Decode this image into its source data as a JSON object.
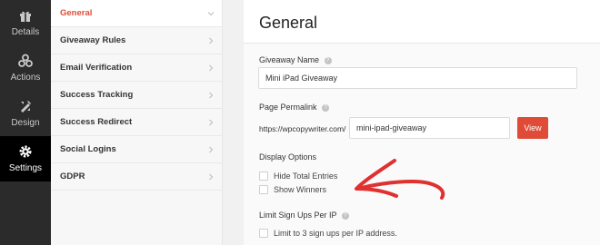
{
  "rail": {
    "items": [
      {
        "label": "Details",
        "icon": "gift-icon"
      },
      {
        "label": "Actions",
        "icon": "actions-icon"
      },
      {
        "label": "Design",
        "icon": "design-icon"
      },
      {
        "label": "Settings",
        "icon": "gear-icon"
      }
    ],
    "active": "Settings"
  },
  "subnav": {
    "items": [
      {
        "label": "General"
      },
      {
        "label": "Giveaway Rules"
      },
      {
        "label": "Email Verification"
      },
      {
        "label": "Success Tracking"
      },
      {
        "label": "Success Redirect"
      },
      {
        "label": "Social Logins"
      },
      {
        "label": "GDPR"
      }
    ],
    "active": "General"
  },
  "main": {
    "title": "General",
    "giveaway_name": {
      "label": "Giveaway Name",
      "value": "Mini iPad Giveaway"
    },
    "permalink": {
      "label": "Page Permalink",
      "prefix": "https://wpcopywriter.com/",
      "value": "mini-ipad-giveaway",
      "view_button": "View"
    },
    "display_options": {
      "label": "Display Options",
      "options": [
        {
          "label": "Hide Total Entries",
          "checked": false
        },
        {
          "label": "Show Winners",
          "checked": false
        }
      ]
    },
    "limit": {
      "label": "Limit Sign Ups Per IP",
      "option": {
        "label": "Limit to 3 sign ups per IP address.",
        "checked": false
      }
    }
  },
  "colors": {
    "accent": "#e04b37",
    "rail_bg": "#2b2b2b",
    "rail_active": "#000000"
  }
}
